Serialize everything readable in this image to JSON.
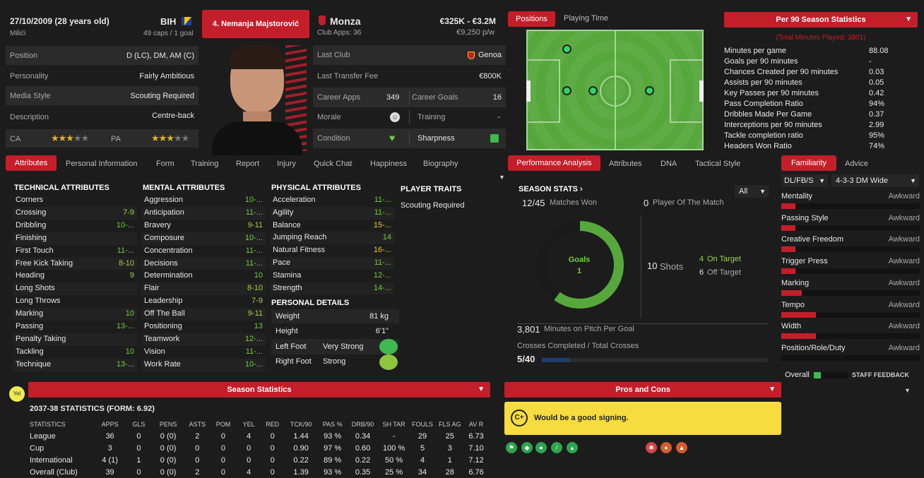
{
  "header": {
    "dob": "27/10/2009 (28 years old)",
    "birthplace": "Milići",
    "nation": "BIH",
    "caps": "49 caps / 1 goal",
    "player_name": "4. Nemanja Majstorović",
    "club": "Monza",
    "club_apps": "Club Apps: 36",
    "value": "€325K - €3.2M",
    "wage": "€9,250 p/w"
  },
  "info": {
    "position_label": "Position",
    "position_value": "D (LC), DM, AM (C)",
    "personality_label": "Personality",
    "personality_value": "Fairly Ambitious",
    "media_label": "Media Style",
    "media_value": "Scouting Required",
    "description_label": "Description",
    "description_value": "Centre-back",
    "ca_label": "CA",
    "pa_label": "PA",
    "ca_stars": 3,
    "pa_stars": 3
  },
  "career": {
    "last_club_label": "Last Club",
    "last_club_value": "Genoa",
    "transfer_fee_label": "Last Transfer Fee",
    "transfer_fee_value": "€800K",
    "career_apps_label": "Career Apps",
    "career_apps_value": "349",
    "career_goals_label": "Career Goals",
    "career_goals_value": "16",
    "morale_label": "Morale",
    "training_label": "Training",
    "training_value": "-",
    "condition_label": "Condition",
    "sharpness_label": "Sharpness"
  },
  "pitch_tabs": {
    "positions": "Positions",
    "playing_time": "Playing Time"
  },
  "per90": {
    "title": "Per 90 Season Statistics",
    "subtitle": "(Total Minutes Played: 3801)",
    "rows": [
      {
        "label": "Minutes per game",
        "value": "88.08"
      },
      {
        "label": "Goals per 90 minutes",
        "value": "-"
      },
      {
        "label": "Chances Created per 90 minutes",
        "value": "0.03"
      },
      {
        "label": "Assists per 90 minutes",
        "value": "0.05"
      },
      {
        "label": "Key Passes per 90 minutes",
        "value": "0.42"
      },
      {
        "label": "Pass Completion Ratio",
        "value": "94%"
      },
      {
        "label": "Dribbles Made Per Game",
        "value": "0.37"
      },
      {
        "label": "Interceptions per 90 minutes",
        "value": "2.99"
      },
      {
        "label": "Tackle completion ratio",
        "value": "95%"
      },
      {
        "label": "Headers Won Ratio",
        "value": "74%"
      }
    ]
  },
  "tabs": [
    "Attributes",
    "Personal Information",
    "Form",
    "Training",
    "Report",
    "Injury",
    "Quick Chat",
    "Happiness",
    "Biography"
  ],
  "perf_tabs": [
    "Performance Analysis",
    "Attributes",
    "DNA",
    "Tactical Style"
  ],
  "fam_tabs": [
    "Familiarity",
    "Advice"
  ],
  "technical": {
    "title": "TECHNICAL ATTRIBUTES",
    "rows": [
      {
        "label": "Corners",
        "value": ""
      },
      {
        "label": "Crossing",
        "value": "7-9"
      },
      {
        "label": "Dribbling",
        "value": "10-..."
      },
      {
        "label": "Finishing",
        "value": ""
      },
      {
        "label": "First Touch",
        "value": "11-..."
      },
      {
        "label": "Free Kick Taking",
        "value": "8-10"
      },
      {
        "label": "Heading",
        "value": "9"
      },
      {
        "label": "Long Shots",
        "value": ""
      },
      {
        "label": "Long Throws",
        "value": ""
      },
      {
        "label": "Marking",
        "value": "10"
      },
      {
        "label": "Passing",
        "value": "13-..."
      },
      {
        "label": "Penalty Taking",
        "value": ""
      },
      {
        "label": "Tackling",
        "value": "10"
      },
      {
        "label": "Technique",
        "value": "13-..."
      }
    ]
  },
  "mental": {
    "title": "MENTAL ATTRIBUTES",
    "rows": [
      {
        "label": "Aggression",
        "value": "10-..."
      },
      {
        "label": "Anticipation",
        "value": "11-..."
      },
      {
        "label": "Bravery",
        "value": "9-11"
      },
      {
        "label": "Composure",
        "value": "10-..."
      },
      {
        "label": "Concentration",
        "value": "11-..."
      },
      {
        "label": "Decisions",
        "value": "11-..."
      },
      {
        "label": "Determination",
        "value": "10"
      },
      {
        "label": "Flair",
        "value": "8-10"
      },
      {
        "label": "Leadership",
        "value": "7-9"
      },
      {
        "label": "Off The Ball",
        "value": "9-11"
      },
      {
        "label": "Positioning",
        "value": "13"
      },
      {
        "label": "Teamwork",
        "value": "12-..."
      },
      {
        "label": "Vision",
        "value": "11-..."
      },
      {
        "label": "Work Rate",
        "value": "10-..."
      }
    ]
  },
  "physical": {
    "title": "PHYSICAL ATTRIBUTES",
    "rows": [
      {
        "label": "Acceleration",
        "value": "11-..."
      },
      {
        "label": "Agility",
        "value": "11-..."
      },
      {
        "label": "Balance",
        "value": "15-..."
      },
      {
        "label": "Jumping Reach",
        "value": "14"
      },
      {
        "label": "Natural Fitness",
        "value": "16-..."
      },
      {
        "label": "Pace",
        "value": "11-..."
      },
      {
        "label": "Stamina",
        "value": "12-..."
      },
      {
        "label": "Strength",
        "value": "14-..."
      }
    ]
  },
  "traits": {
    "title": "PLAYER TRAITS",
    "value": "Scouting Required"
  },
  "personal": {
    "title": "PERSONAL DETAILS",
    "weight_label": "Weight",
    "weight_value": "81 kg",
    "height_label": "Height",
    "height_value": "6'1\"",
    "left_foot_label": "Left Foot",
    "left_foot_value": "Very Strong",
    "right_foot_label": "Right Foot",
    "right_foot_value": "Strong"
  },
  "season_stats": {
    "title": "SEASON STATS",
    "filter": "All",
    "matches_won": "12/45",
    "matches_won_label": "Matches Won",
    "potm": "0",
    "potm_label": "Player Of The Match",
    "goals_label": "Goals",
    "goals_value": "1",
    "shots": "10",
    "shots_label": "Shots",
    "on_target": "4",
    "on_target_label": "On Target",
    "off_target": "6",
    "off_target_label": "Off Target",
    "minutes_per_goal": "3,801",
    "minutes_per_goal_label": "Minutes on Pitch Per Goal",
    "crosses_label": "Crosses Completed / Total Crosses",
    "crosses_value": "5/40",
    "crosses_fraction": 0.125,
    "donut_fraction": 0.6
  },
  "familiarity": {
    "position": "DL/FB/S",
    "formation": "4-3-3 DM Wide",
    "rows": [
      {
        "label": "Mentality",
        "value": "Awkward",
        "fill": 0.1
      },
      {
        "label": "Passing Style",
        "value": "Awkward",
        "fill": 0.1
      },
      {
        "label": "Creative Freedom",
        "value": "Awkward",
        "fill": 0.1
      },
      {
        "label": "Trigger Press",
        "value": "Awkward",
        "fill": 0.1
      },
      {
        "label": "Marking",
        "value": "Awkward",
        "fill": 0.15
      },
      {
        "label": "Tempo",
        "value": "Awkward",
        "fill": 0.25
      },
      {
        "label": "Width",
        "value": "Awkward",
        "fill": 0.25
      },
      {
        "label": "Position/Role/Duty",
        "value": "Awkward",
        "fill": 0
      }
    ],
    "overall_label": "Overall",
    "staff_feedback": "STAFF FEEDBACK"
  },
  "season_table": {
    "bar_title": "Season Statistics",
    "title": "2037-38 STATISTICS (FORM: 6.92)",
    "badge": "Yel",
    "headers": [
      "STATISTICS",
      "APPS",
      "GLS",
      "PENS",
      "ASTS",
      "POM",
      "YEL",
      "RED",
      "TCK/90",
      "PAS %",
      "DRB/90",
      "SH TAR",
      "FOULS",
      "FLS AG",
      "AV R"
    ],
    "rows": [
      [
        "League",
        "36",
        "0",
        "0 (0)",
        "2",
        "0",
        "4",
        "0",
        "1.44",
        "93 %",
        "0.34",
        "-",
        "29",
        "25",
        "6.73"
      ],
      [
        "Cup",
        "3",
        "0",
        "0 (0)",
        "0",
        "0",
        "0",
        "0",
        "0.90",
        "97 %",
        "0.60",
        "100 %",
        "5",
        "3",
        "7.10"
      ],
      [
        "International",
        "4 (1)",
        "1",
        "0 (0)",
        "0",
        "0",
        "0",
        "0",
        "0.22",
        "89 %",
        "0.22",
        "50 %",
        "4",
        "1",
        "7.12"
      ],
      [
        "Overall (Club)",
        "39",
        "0",
        "0 (0)",
        "2",
        "0",
        "4",
        "0",
        "1.39",
        "93 %",
        "0.35",
        "25 %",
        "34",
        "28",
        "6.76"
      ]
    ]
  },
  "pros_cons": {
    "title": "Pros and Cons",
    "grade": "C+",
    "verdict": "Would be a good signing."
  },
  "colors": {
    "accent": "#c41e2a",
    "pitch": "#56a83c",
    "positive": "#6fcf3a"
  }
}
